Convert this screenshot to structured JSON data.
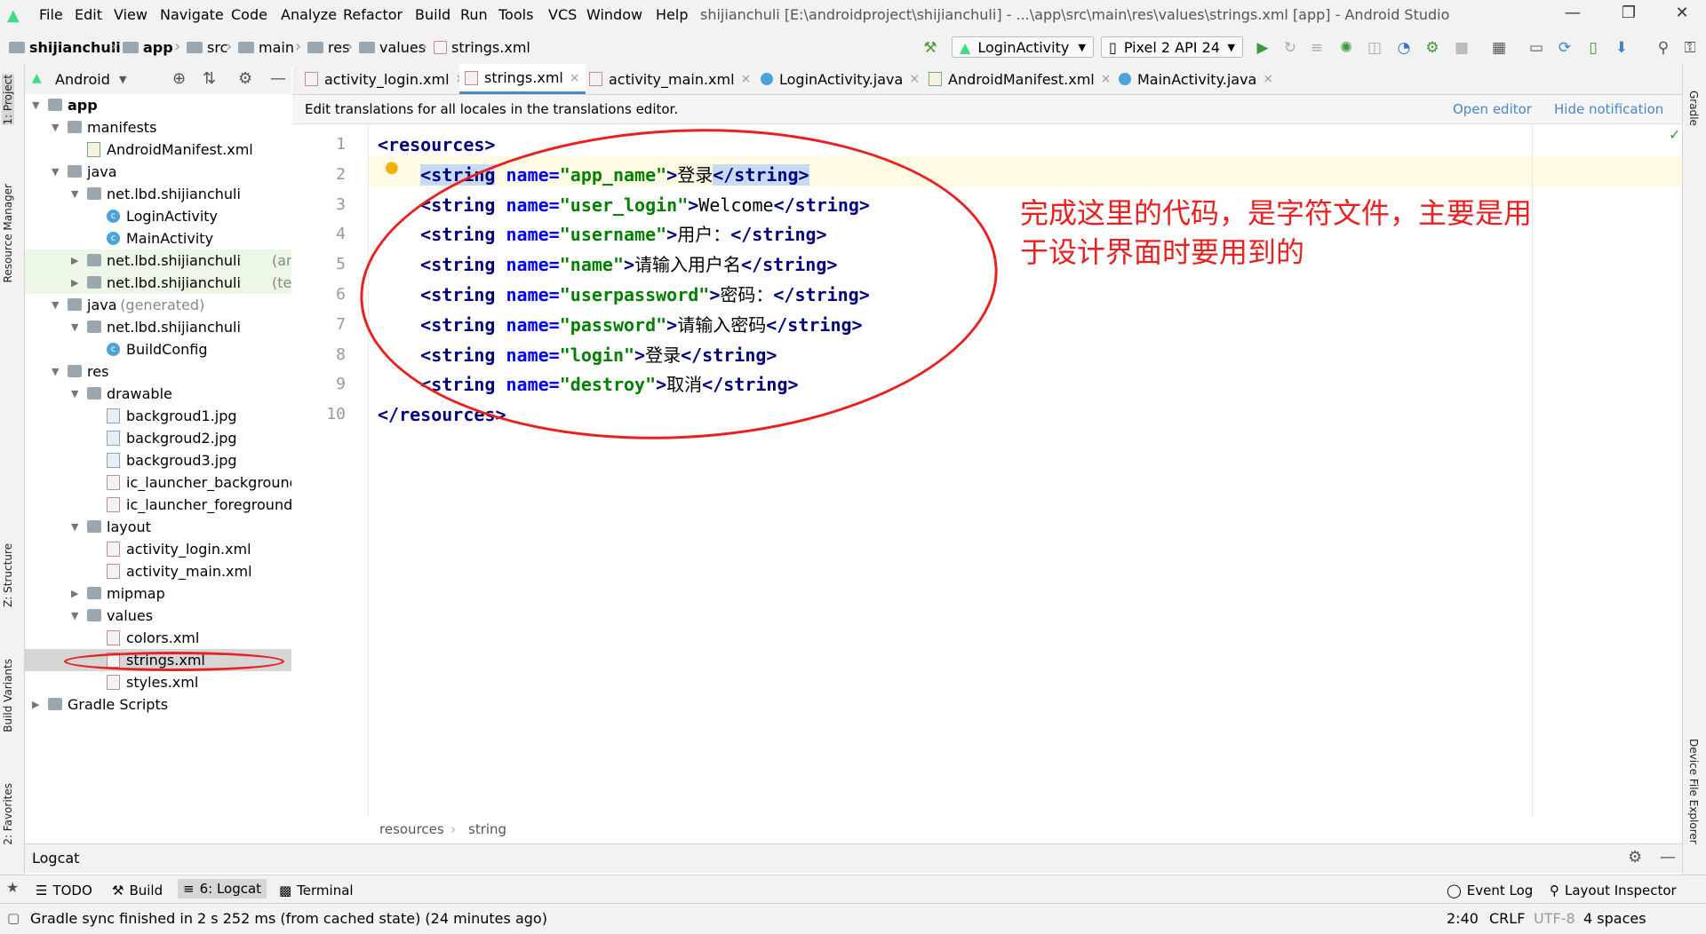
{
  "menubar": {
    "items": [
      "File",
      "Edit",
      "View",
      "Navigate",
      "Code",
      "Analyze",
      "Refactor",
      "Build",
      "Run",
      "Tools",
      "VCS",
      "Window",
      "Help"
    ],
    "window_title": "shijianchuli [E:\\androidproject\\shijianchuli] - ...\\app\\src\\main\\res\\values\\strings.xml [app] - Android Studio"
  },
  "breadcrumbs": [
    "shijianchuli",
    "app",
    "src",
    "main",
    "res",
    "values",
    "strings.xml"
  ],
  "toolbar": {
    "run_config": "LoginActivity",
    "device": "Pixel 2 API 24"
  },
  "left_stripe": {
    "project": "1: Project",
    "resource_manager": "Resource Manager",
    "structure": "Z: Structure",
    "build_variants": "Build Variants",
    "favorites": "2: Favorites"
  },
  "right_stripe": {
    "gradle": "Gradle",
    "device_file_explorer": "Device File Explorer"
  },
  "project_panel": {
    "view_mode": "Android",
    "tree": [
      {
        "label": "app",
        "suffix": "",
        "depth": 0,
        "icon": "module-icon",
        "expanded": true
      },
      {
        "label": "manifests",
        "suffix": "",
        "depth": 1,
        "icon": "folder-icon",
        "expanded": true
      },
      {
        "label": "AndroidManifest.xml",
        "suffix": "",
        "depth": 2,
        "icon": "manifest-file-icon",
        "expanded": null
      },
      {
        "label": "java",
        "suffix": "",
        "depth": 1,
        "icon": "folder-icon",
        "expanded": true
      },
      {
        "label": "net.lbd.shijianchuli",
        "suffix": "",
        "depth": 2,
        "icon": "package-icon",
        "expanded": true
      },
      {
        "label": "LoginActivity",
        "suffix": "",
        "depth": 3,
        "icon": "class-icon",
        "expanded": null
      },
      {
        "label": "MainActivity",
        "suffix": "",
        "depth": 3,
        "icon": "class-icon",
        "expanded": null
      },
      {
        "label": "net.lbd.shijianchuli",
        "suffix": " (androidT",
        "depth": 2,
        "icon": "package-icon",
        "expanded": false
      },
      {
        "label": "net.lbd.shijianchuli",
        "suffix": " (test)",
        "depth": 2,
        "icon": "package-icon",
        "expanded": false
      },
      {
        "label": "java",
        "suffix": " (generated)",
        "depth": 1,
        "icon": "folder-icon",
        "expanded": true
      },
      {
        "label": "net.lbd.shijianchuli",
        "suffix": "",
        "depth": 2,
        "icon": "package-icon",
        "expanded": true
      },
      {
        "label": "BuildConfig",
        "suffix": "",
        "depth": 3,
        "icon": "class-icon",
        "expanded": null
      },
      {
        "label": "res",
        "suffix": "",
        "depth": 1,
        "icon": "folder-icon",
        "expanded": true
      },
      {
        "label": "drawable",
        "suffix": "",
        "depth": 2,
        "icon": "folder-icon",
        "expanded": true
      },
      {
        "label": "backgroud1.jpg",
        "suffix": "",
        "depth": 3,
        "icon": "image-file-icon",
        "expanded": null
      },
      {
        "label": "backgroud2.jpg",
        "suffix": "",
        "depth": 3,
        "icon": "image-file-icon",
        "expanded": null
      },
      {
        "label": "backgroud3.jpg",
        "suffix": "",
        "depth": 3,
        "icon": "image-file-icon",
        "expanded": null
      },
      {
        "label": "ic_launcher_background.x",
        "suffix": "",
        "depth": 3,
        "icon": "xml-file-icon",
        "expanded": null
      },
      {
        "label": "ic_launcher_foreground.x",
        "suffix": "",
        "depth": 3,
        "icon": "xml-file-icon",
        "expanded": null
      },
      {
        "label": "layout",
        "suffix": "",
        "depth": 2,
        "icon": "folder-icon",
        "expanded": true
      },
      {
        "label": "activity_login.xml",
        "suffix": "",
        "depth": 3,
        "icon": "xml-file-icon",
        "expanded": null
      },
      {
        "label": "activity_main.xml",
        "suffix": "",
        "depth": 3,
        "icon": "xml-file-icon",
        "expanded": null
      },
      {
        "label": "mipmap",
        "suffix": "",
        "depth": 2,
        "icon": "folder-icon",
        "expanded": false
      },
      {
        "label": "values",
        "suffix": "",
        "depth": 2,
        "icon": "folder-icon",
        "expanded": true
      },
      {
        "label": "colors.xml",
        "suffix": "",
        "depth": 3,
        "icon": "xml-file-icon",
        "expanded": null
      },
      {
        "label": "strings.xml",
        "suffix": "",
        "depth": 3,
        "icon": "xml-file-icon",
        "expanded": null
      },
      {
        "label": "styles.xml",
        "suffix": "",
        "depth": 3,
        "icon": "xml-file-icon",
        "expanded": null
      },
      {
        "label": "Gradle Scripts",
        "suffix": "",
        "depth": 0,
        "icon": "gradle-icon",
        "expanded": false
      }
    ]
  },
  "editor_tabs": [
    {
      "label": "activity_login.xml",
      "icon": "xml-file-icon",
      "active": false
    },
    {
      "label": "strings.xml",
      "icon": "xml-file-icon",
      "active": true
    },
    {
      "label": "activity_main.xml",
      "icon": "xml-file-icon",
      "active": false
    },
    {
      "label": "LoginActivity.java",
      "icon": "class-icon",
      "active": false
    },
    {
      "label": "AndroidManifest.xml",
      "icon": "manifest-file-icon",
      "active": false
    },
    {
      "label": "MainActivity.java",
      "icon": "class-icon",
      "active": false
    }
  ],
  "notification": {
    "message": "Edit translations for all locales in the translations editor.",
    "open_editor": "Open editor",
    "hide": "Hide notification"
  },
  "code_lines": [
    {
      "num": "1",
      "indent": "",
      "name": "",
      "text": "",
      "kind": "open"
    },
    {
      "num": "2",
      "indent": "    ",
      "name": "app_name",
      "text": "登录",
      "kind": "string"
    },
    {
      "num": "3",
      "indent": "    ",
      "name": "user_login",
      "text": "Welcome",
      "kind": "string"
    },
    {
      "num": "4",
      "indent": "    ",
      "name": "username",
      "text": "用户：",
      "kind": "string"
    },
    {
      "num": "5",
      "indent": "    ",
      "name": "name",
      "text": "请输入用户名",
      "kind": "string"
    },
    {
      "num": "6",
      "indent": "    ",
      "name": "userpassword",
      "text": "密码：",
      "kind": "string"
    },
    {
      "num": "7",
      "indent": "    ",
      "name": "password",
      "text": "请输入密码",
      "kind": "string"
    },
    {
      "num": "8",
      "indent": "    ",
      "name": "login",
      "text": "登录",
      "kind": "string"
    },
    {
      "num": "9",
      "indent": "    ",
      "name": "destroy",
      "text": "取消",
      "kind": "string"
    },
    {
      "num": "10",
      "indent": "",
      "name": "",
      "text": "",
      "kind": "close"
    }
  ],
  "editor_breadcrumb": [
    "resources",
    "string"
  ],
  "annotation_text": "完成这里的代码，是字符文件，主要是用于设计界面时要用到的",
  "logcat_panel": {
    "title": "Logcat"
  },
  "bottom_tools": {
    "todo": "TODO",
    "build": "Build",
    "logcat": "6: Logcat",
    "terminal": "Terminal",
    "event_log": "Event Log",
    "layout_inspector": "Layout Inspector"
  },
  "status": {
    "message": "Gradle sync finished in 2 s 252 ms (from cached state) (24 minutes ago)",
    "position": "2:40",
    "line_sep": "CRLF",
    "encoding": "UTF-8",
    "indent": "4 spaces"
  },
  "colors": {
    "annotation": "#e82020",
    "tag": "#000080",
    "attribute": "#0000ff",
    "value": "#008000",
    "link": "#4a88c7"
  }
}
